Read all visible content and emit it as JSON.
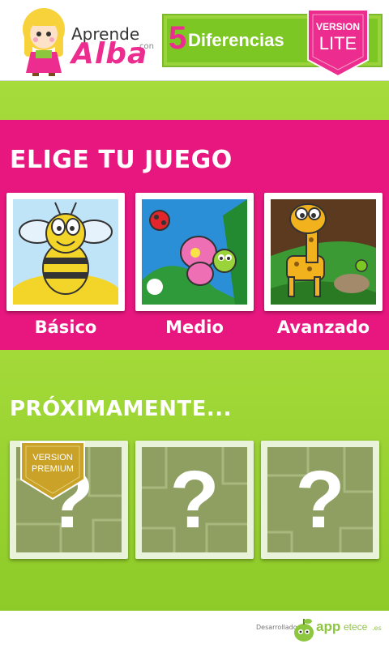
{
  "header": {
    "logo_text_1": "Aprende",
    "logo_text_2": "con",
    "logo_text_3": "Alba",
    "title_number": "5",
    "title_text": "Diferencias",
    "version_small": "VERSION",
    "version_big": "LITE"
  },
  "games_section": {
    "title": "ELIGE TU JUEGO",
    "items": [
      {
        "label": "Básico",
        "picture": "bee-character"
      },
      {
        "label": "Medio",
        "picture": "butterfly-ladybug-character"
      },
      {
        "label": "Avanzado",
        "picture": "giraffe-character"
      }
    ]
  },
  "coming_soon_section": {
    "title": "PRÓXIMAMENTE...",
    "items": [
      {
        "symbol": "?"
      },
      {
        "symbol": "?"
      },
      {
        "symbol": "?"
      }
    ],
    "premium_badge_1": "VERSION",
    "premium_badge_2": "PREMIUM"
  },
  "footer": {
    "developed_by": "Desarrollado por",
    "brand_a": "app",
    "brand_b": "etece",
    "brand_tld": ".es"
  },
  "colors": {
    "pink": "#e8177f",
    "green": "#95d02c",
    "gold": "#c9a227"
  }
}
